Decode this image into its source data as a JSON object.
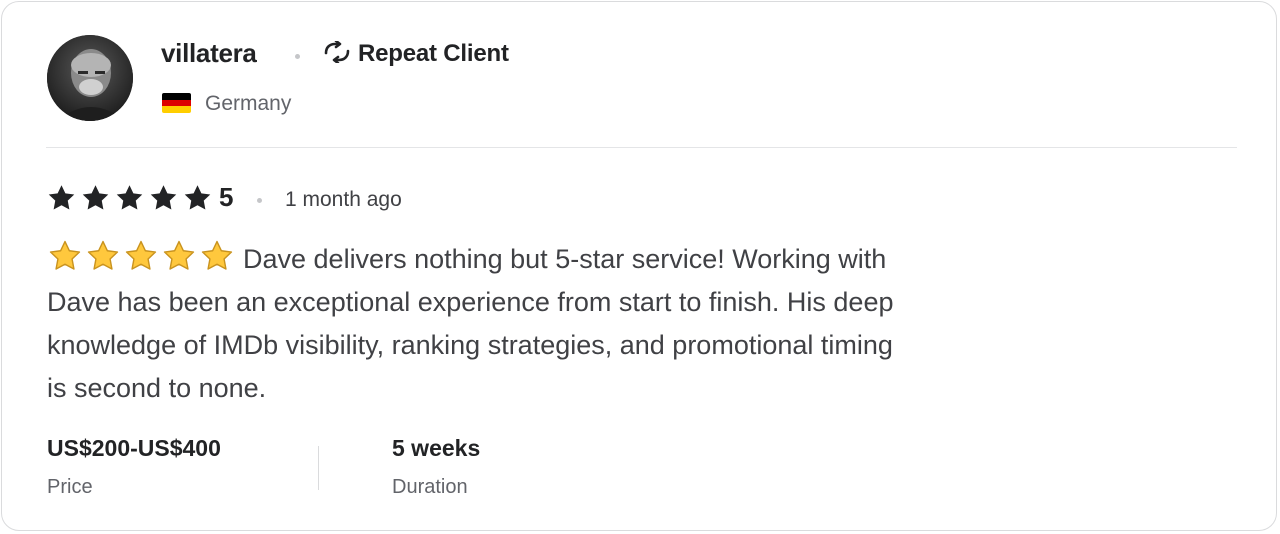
{
  "reviewer": {
    "username": "villatera",
    "badge_icon": "repeat-icon",
    "badge_label": "Repeat Client",
    "country": "Germany",
    "flag_colors": [
      "#000000",
      "#dd0000",
      "#ffce00"
    ]
  },
  "rating": {
    "value": "5",
    "star_color": "#222325",
    "time_ago": "1 month ago"
  },
  "review": {
    "emoji_icon": "star-emoji",
    "emoji_star_color": "#ffc83d",
    "text": "Dave delivers nothing but 5-star service! Working with Dave has been an exceptional experience from start to finish. His deep knowledge of IMDb visibility, ranking strategies, and promotional timing is second to none."
  },
  "details": {
    "price_value": "US$200-US$400",
    "price_label": "Price",
    "duration_value": "5 weeks",
    "duration_label": "Duration"
  }
}
